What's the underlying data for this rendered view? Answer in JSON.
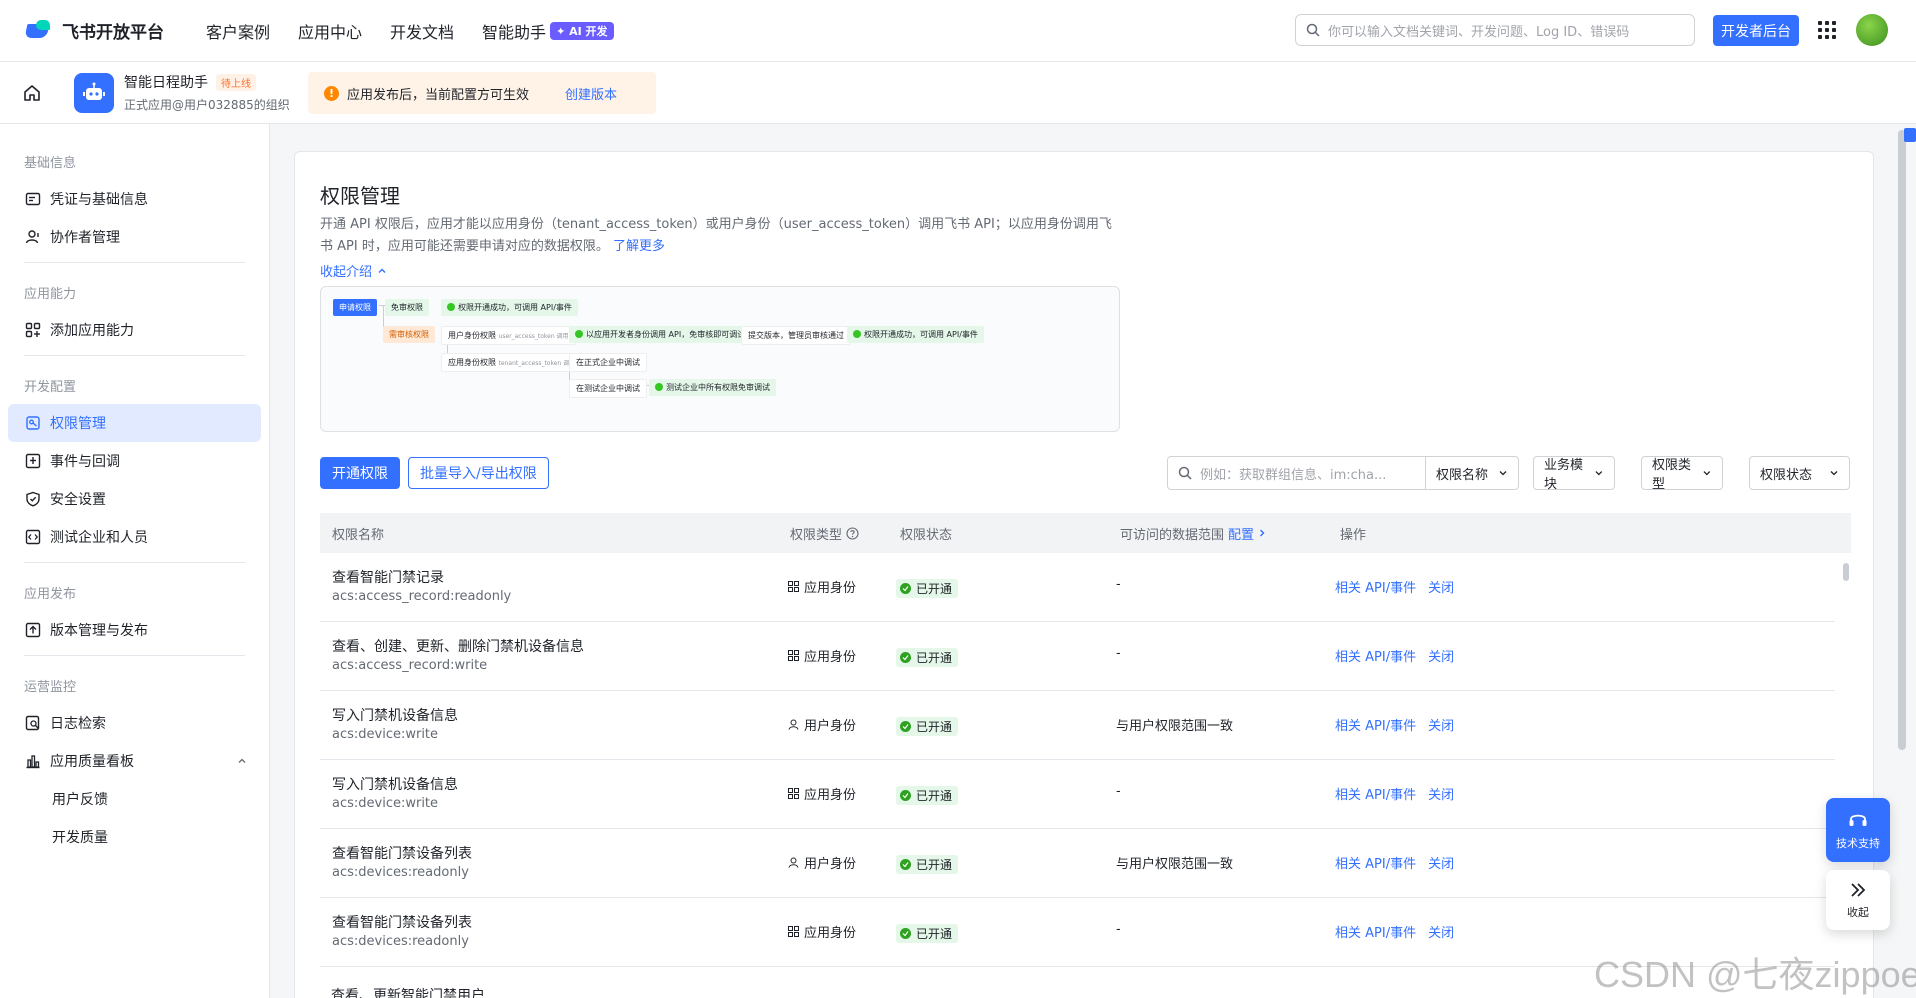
{
  "topnav": {
    "brand": "飞书开放平台",
    "items": [
      "客户案例",
      "应用中心",
      "开发文档",
      "智能助手"
    ],
    "ai_badge": "✦ AI 开发",
    "search_placeholder": "你可以输入文档关键词、开发问题、Log ID、错误码",
    "dev_console": "开发者后台"
  },
  "appbar": {
    "app_name": "智能日程助手",
    "status_tag": "待上线",
    "org": "正式应用@用户032885的组织",
    "notice": "应用发布后，当前配置方可生效",
    "notice_link": "创建版本"
  },
  "sidebar": {
    "sections": [
      {
        "title": "基础信息",
        "items": [
          "凭证与基础信息",
          "协作者管理"
        ]
      },
      {
        "title": "应用能力",
        "items": [
          "添加应用能力"
        ]
      },
      {
        "title": "开发配置",
        "items": [
          "权限管理",
          "事件与回调",
          "安全设置",
          "测试企业和人员"
        ]
      },
      {
        "title": "应用发布",
        "items": [
          "版本管理与发布"
        ]
      },
      {
        "title": "运营监控",
        "items": [
          "日志检索",
          "应用质量看板",
          "用户反馈",
          "开发质量"
        ]
      }
    ]
  },
  "main": {
    "title": "权限管理",
    "desc": "开通 API 权限后，应用才能以应用身份（tenant_access_token）或用户身份（user_access_token）调用飞书 API；以应用身份调用飞书 API 时，应用可能还需要申请对应的数据权限。",
    "learn_more": "了解更多",
    "collapse": "收起介绍",
    "flow": {
      "apply": "申请权限",
      "free": "免审权限",
      "free_ok": "权限开通成功，可调用 API/事件",
      "review": "需审核权限",
      "user_id": "用户身份权限",
      "user_token": "user_access_token 调用",
      "dev_ok": "以应用开发者身份调用 API，免审核即可调试",
      "submit": "提交版本，管理员审核通过",
      "final_ok": "权限开通成功，可调用 API/事件",
      "app_id": "应用身份权限",
      "app_token": "tenant_access_token 调用",
      "prod": "在正式企业中调试",
      "test": "在测试企业中调试",
      "test_ok": "测试企业中所有权限免审调试"
    },
    "btn_open": "开通权限",
    "btn_batch": "批量导入/导出权限",
    "filter_placeholder": "例如：获取群组信息、im:cha...",
    "filters": [
      "权限名称",
      "业务模块",
      "权限类型",
      "权限状态"
    ],
    "columns": {
      "name": "权限名称",
      "type": "权限类型",
      "status": "权限状态",
      "scope": "可访问的数据范围",
      "scope_config": "配置",
      "ops": "操作"
    },
    "rows": [
      {
        "name": "查看智能门禁记录",
        "code": "acs:access_record:readonly",
        "type": "应用身份",
        "type_icon": "grid-icon",
        "status": "已开通",
        "scope": "-",
        "op1": "相关 API/事件",
        "op2": "关闭"
      },
      {
        "name": "查看、创建、更新、删除门禁机设备信息",
        "code": "acs:access_record:write",
        "type": "应用身份",
        "type_icon": "grid-icon",
        "status": "已开通",
        "scope": "-",
        "op1": "相关 API/事件",
        "op2": "关闭"
      },
      {
        "name": "写入门禁机设备信息",
        "code": "acs:device:write",
        "type": "用户身份",
        "type_icon": "user-icon",
        "status": "已开通",
        "scope": "与用户权限范围一致",
        "op1": "相关 API/事件",
        "op2": "关闭"
      },
      {
        "name": "写入门禁机设备信息",
        "code": "acs:device:write",
        "type": "应用身份",
        "type_icon": "grid-icon",
        "status": "已开通",
        "scope": "-",
        "op1": "相关 API/事件",
        "op2": "关闭"
      },
      {
        "name": "查看智能门禁设备列表",
        "code": "acs:devices:readonly",
        "type": "用户身份",
        "type_icon": "user-icon",
        "status": "已开通",
        "scope": "与用户权限范围一致",
        "op1": "相关 API/事件",
        "op2": "关闭"
      },
      {
        "name": "查看智能门禁设备列表",
        "code": "acs:devices:readonly",
        "type": "应用身份",
        "type_icon": "grid-icon",
        "status": "已开通",
        "scope": "-",
        "op1": "相关 API/事件",
        "op2": "关闭"
      }
    ],
    "last_row_peek": "查看、更新智能门禁用户"
  },
  "floats": {
    "support": "技术支持",
    "collapse": "收起"
  },
  "watermark": "CSDN @七夜zippoe",
  "colors": {
    "accent": "#3370ff",
    "success": "#2ea121",
    "warning": "#ff8800"
  }
}
